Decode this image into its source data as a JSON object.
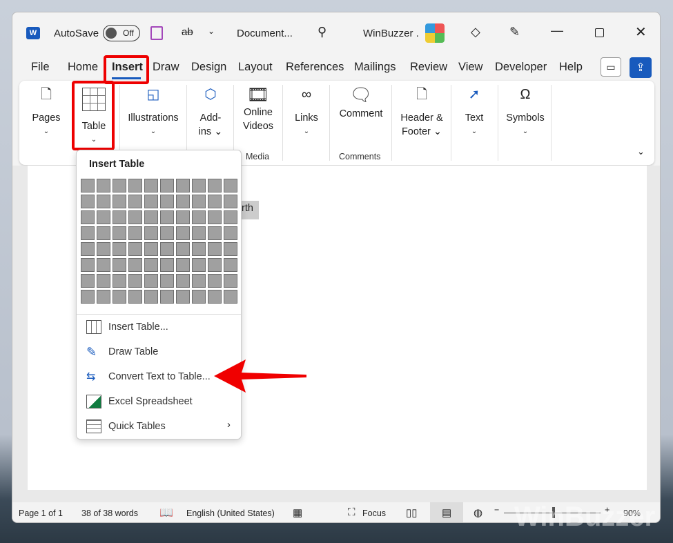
{
  "titlebar": {
    "autosave": "AutoSave",
    "toggle": "Off",
    "document": "Document...",
    "user": "WinBuzzer ."
  },
  "tabs": [
    "File",
    "Home",
    "Insert",
    "Draw",
    "Design",
    "Layout",
    "References",
    "Mailings",
    "Review",
    "View",
    "Developer",
    "Help"
  ],
  "ribbon": {
    "pages": "Pages",
    "table": "Table",
    "illustrations": "Illustrations",
    "addins1": "Add-",
    "addins2": "ins",
    "online1": "Online",
    "online2": "Videos",
    "media": "Media",
    "links": "Links",
    "comment": "Comment",
    "comments": "Comments",
    "hf1": "Header &",
    "hf2": "Footer",
    "text": "Text",
    "symbols": "Symbols"
  },
  "doc": {
    "text": "rth"
  },
  "menu": {
    "title": "Insert Table",
    "grid_cols": 10,
    "grid_rows": 8,
    "items": [
      "Insert Table...",
      "Draw Table",
      "Convert Text to Table...",
      "Excel Spreadsheet",
      "Quick Tables"
    ]
  },
  "status": {
    "page": "Page 1 of 1",
    "words": "38 of 38 words",
    "lang": "English (United States)",
    "focus": "Focus",
    "zoom": "90%"
  },
  "watermark": "WinBuzzer",
  "colors": {
    "accent": "#185abd",
    "highlight": "#e00000",
    "arrow": "#f00000"
  }
}
